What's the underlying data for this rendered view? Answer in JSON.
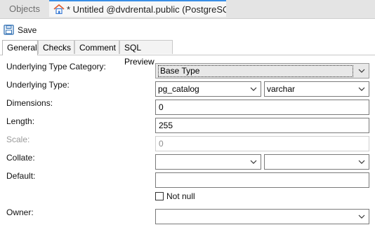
{
  "doc_tabs": {
    "objects_label": "Objects",
    "active_label": "* Untitled @dvdrental.public (PostgreSQ..."
  },
  "toolbar": {
    "save_label": "Save"
  },
  "section_tabs": [
    "General",
    "Checks",
    "Comment",
    "SQL Preview"
  ],
  "form": {
    "underlying_type_category": {
      "label": "Underlying Type Category:",
      "value": "Base Type"
    },
    "underlying_type": {
      "label": "Underlying Type:",
      "schema": "pg_catalog",
      "type": "varchar"
    },
    "dimensions": {
      "label": "Dimensions:",
      "value": "0"
    },
    "length": {
      "label": "Length:",
      "value": "255"
    },
    "scale": {
      "label": "Scale:",
      "value": "0"
    },
    "collate": {
      "label": "Collate:",
      "schema": "",
      "value": ""
    },
    "default": {
      "label": "Default:",
      "value": ""
    },
    "not_null": {
      "label": "Not null",
      "checked": false
    },
    "owner": {
      "label": "Owner:",
      "value": ""
    }
  },
  "colors": {
    "active_tab_accent": "#3a8ee6",
    "window_bg": "#ffffff",
    "tab_strip_bg": "#e4e4e4"
  }
}
